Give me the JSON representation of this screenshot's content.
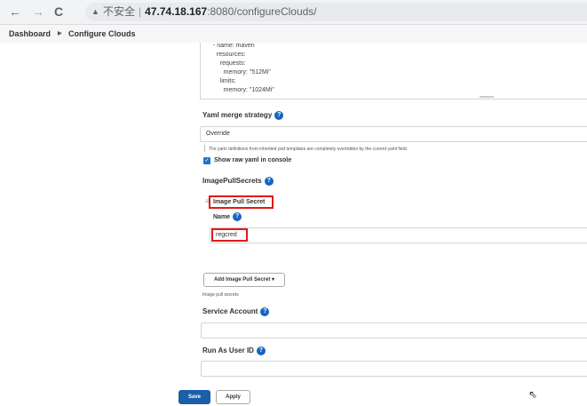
{
  "browser": {
    "back_icon": "←",
    "forward_icon": "→",
    "reload_icon": "C",
    "insecure_label": "不安全",
    "host": "47.74.18.167",
    "path": ":8080/configureClouds/"
  },
  "breadcrumb": {
    "items": [
      "Dashboard",
      "Configure Clouds"
    ]
  },
  "yaml": {
    "lines": [
      "- name: maven",
      "  resources:",
      "    requests:",
      "      memory: \"512Mi\"",
      "    limits:",
      "      memory: \"1024Mi\""
    ]
  },
  "form": {
    "yaml_merge_strategy": {
      "label": "Yaml merge strategy",
      "value": "Override",
      "description": "The yaml definitions from inherited pod templates are completely overridden by the current yaml field."
    },
    "show_raw_yaml": {
      "label": "Show raw yaml in console",
      "checked": true
    },
    "image_pull_secrets": {
      "label": "ImagePullSecrets",
      "item_title": "Image Pull Secret",
      "name_label": "Name",
      "name_value": "regcred",
      "add_button": "Add Image Pull Secret",
      "help_text": "Image pull secrets"
    },
    "service_account": {
      "label": "Service Account",
      "value": ""
    },
    "run_as_user_id": {
      "label": "Run As User ID",
      "value": ""
    }
  },
  "actions": {
    "save": "Save",
    "apply": "Apply"
  },
  "colors": {
    "accent": "#1a5fa8",
    "highlight_box": "#e01919"
  }
}
